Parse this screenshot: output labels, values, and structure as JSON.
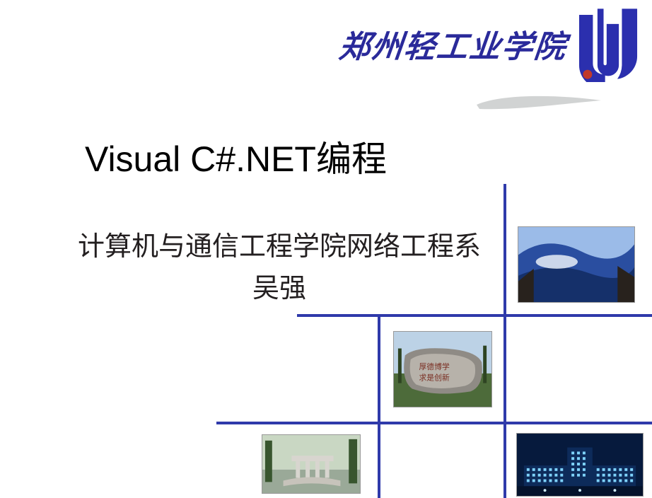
{
  "header": {
    "school_name_calligraphy": "郑州轻工业学院",
    "logo_label": "school-logo"
  },
  "title": "Visual C#.NET编程",
  "subtitle_line1": "计算机与通信工程学院网络工程系",
  "subtitle_line2": "吴强",
  "colors": {
    "accent": "#2f3aaa",
    "logo_red": "#c0392b"
  },
  "thumbnails": [
    {
      "name": "campus-sky-photo"
    },
    {
      "name": "engraved-stone-photo"
    },
    {
      "name": "campus-pavilion-photo"
    },
    {
      "name": "campus-night-building-photo"
    }
  ]
}
